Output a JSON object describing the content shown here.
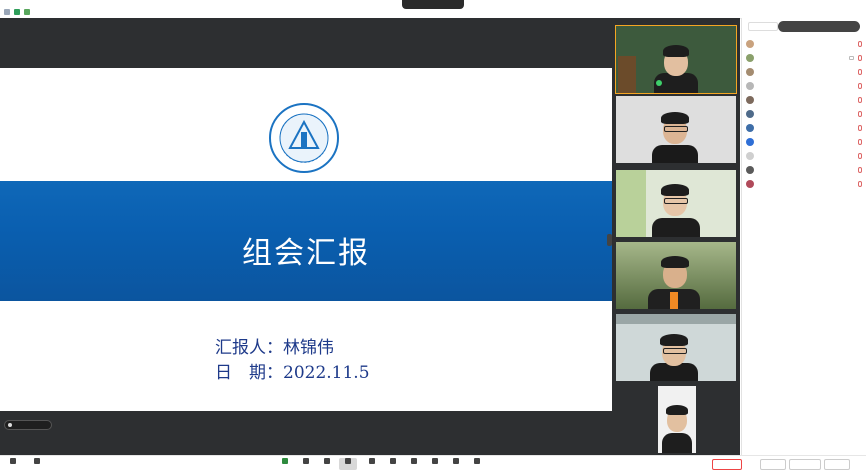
{
  "window": {
    "title": ""
  },
  "top_right": {
    "items": [
      "",
      "",
      "",
      ""
    ]
  },
  "slide": {
    "title": "组会汇报",
    "reporter_label": "汇报人：",
    "reporter_name": "林锦伟",
    "date_label": "日　期：",
    "date_value": "2022.11.5",
    "band_color": "#0b62b3"
  },
  "share_pill": {
    "label": ""
  },
  "gallery": {
    "tiles": [
      {
        "name": "",
        "active": true
      },
      {
        "name": ""
      },
      {
        "name": ""
      },
      {
        "name": ""
      },
      {
        "name": ""
      },
      {
        "name": ""
      }
    ]
  },
  "participants_panel": {
    "search_placeholder": "",
    "notice": "",
    "participants": [
      {
        "name": "",
        "avatar_color": "#c9a27e"
      },
      {
        "name": "",
        "avatar_color": "#8aa06b"
      },
      {
        "name": "",
        "avatar_color": "#a48c70"
      },
      {
        "name": "",
        "avatar_color": "#b7b7b7"
      },
      {
        "name": "",
        "avatar_color": "#7d6a5d"
      },
      {
        "name": "",
        "avatar_color": "#4f6b8a"
      },
      {
        "name": "",
        "avatar_color": "#3e6ea8"
      },
      {
        "name": "",
        "avatar_color": "#2f6fd6"
      },
      {
        "name": "",
        "avatar_color": "#cfcfcf"
      },
      {
        "name": "",
        "avatar_color": "#5a5a5a"
      },
      {
        "name": "",
        "avatar_color": "#b04a5a"
      }
    ]
  },
  "toolbar": {
    "items": [
      {
        "label": "",
        "icon": "mic-icon"
      },
      {
        "label": "",
        "icon": "video-icon"
      },
      {
        "label": "",
        "icon": "share-screen-icon"
      },
      {
        "label": "",
        "icon": "security-icon"
      },
      {
        "label": "",
        "icon": "invite-icon"
      },
      {
        "label": "",
        "icon": "members-icon"
      },
      {
        "label": "",
        "icon": "chat-icon"
      },
      {
        "label": "",
        "icon": "record-icon"
      },
      {
        "label": "",
        "icon": "reaction-icon"
      },
      {
        "label": "",
        "icon": "apps-icon"
      },
      {
        "label": "",
        "icon": "layout-icon"
      },
      {
        "label": "",
        "icon": "settings-icon"
      }
    ],
    "end_button": "",
    "panel_buttons": [
      "",
      "",
      ""
    ]
  }
}
